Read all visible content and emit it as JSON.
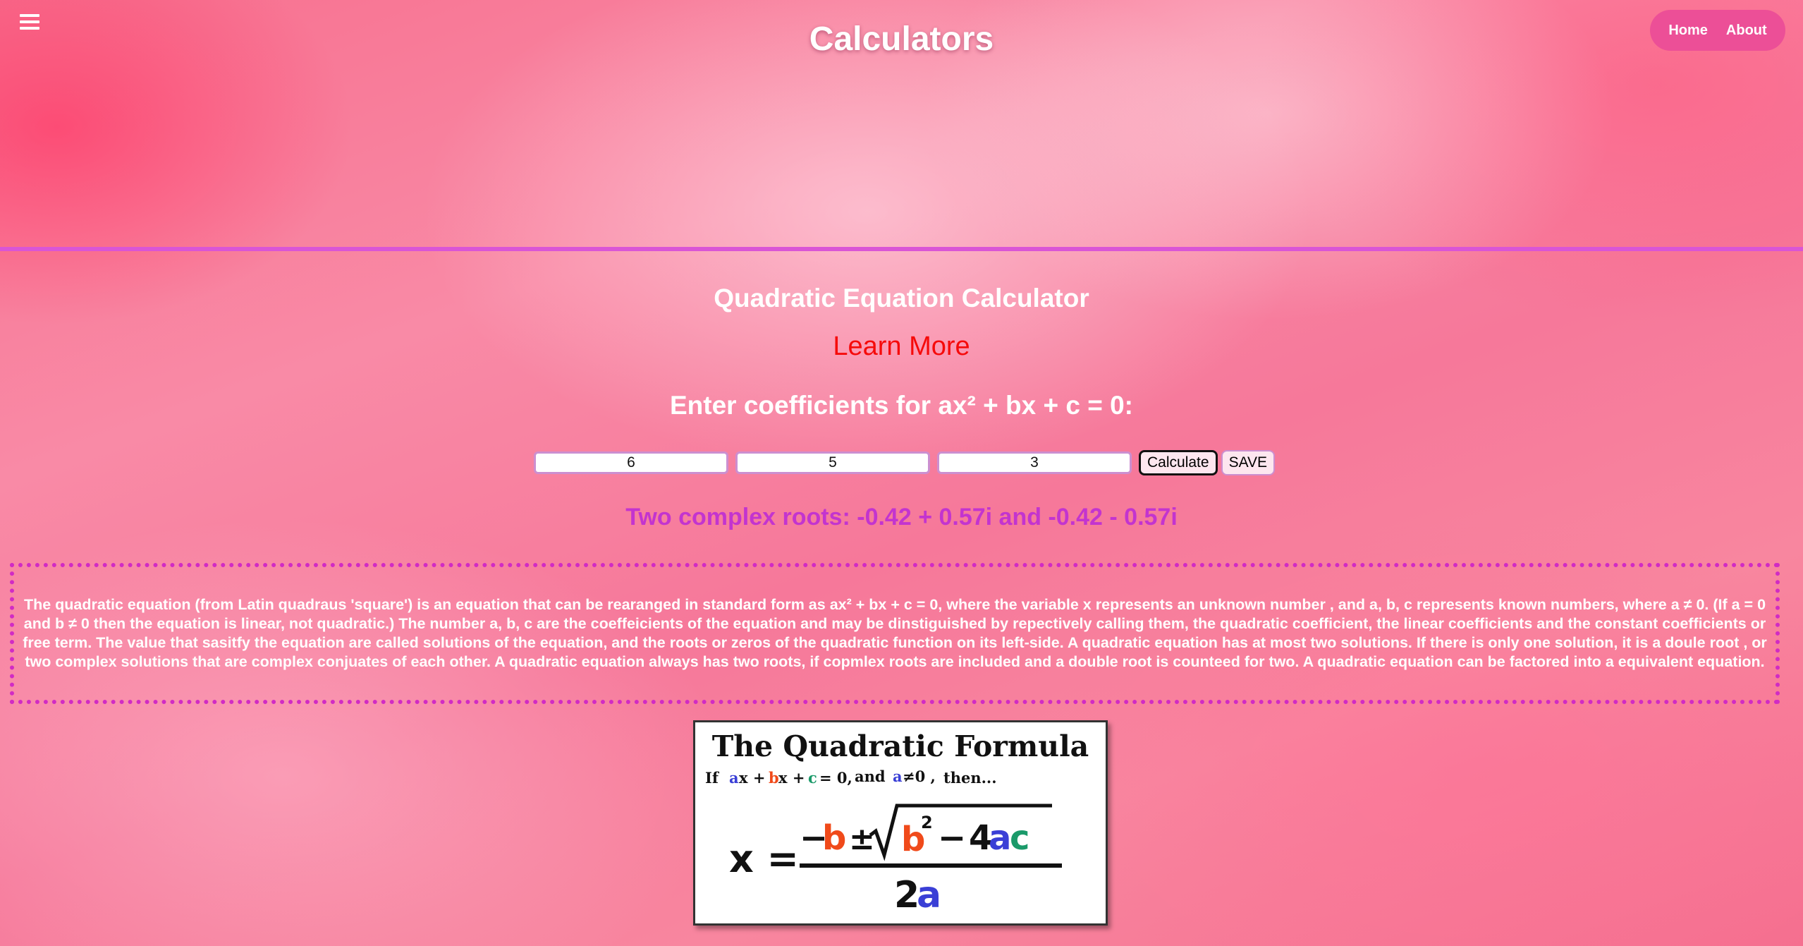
{
  "header": {
    "title": "Calculators",
    "nav": [
      {
        "label": "Home"
      },
      {
        "label": "About"
      }
    ]
  },
  "calculator": {
    "title": "Quadratic Equation Calculator",
    "learn_more": "Learn More",
    "prompt": "Enter coefficients for ax² + bx + c = 0:",
    "inputs": {
      "a": "6",
      "b": "5",
      "c": "3"
    },
    "calculate_label": "Calculate",
    "save_label": "SAVE",
    "result": "Two complex roots: -0.42 + 0.57i and -0.42 - 0.57i"
  },
  "description": "The quadratic equation (from Latin quadraus 'square') is an equation that can be rearanged in standard form as ax² + bx + c = 0, where the variable x represents an unknown number , and a, b, c represents known numbers, where a ≠ 0. (If a = 0 and b ≠ 0 then the equation is linear, not quadratic.) The number a, b, c are the coeffeicients of the equation and may be dinstiguished by repectively calling them, the quadratic coefficient, the linear coefficients and the constant coefficients or free term. The value that sasitfy the equation are called solutions of the equation, and the roots or zeros of the quadratic function on its left-side. A quadratic equation has at most two solutions. If there is only one solution, it is a doule root , or two complex solutions that are complex conjuates of each other. A quadratic equation always has two roots, if copmlex roots are included and a double root is counteed for two. A quadratic equation can be factored into a equivalent equation.",
  "formula_image": {
    "title": "The Quadratic Formula",
    "condition_if": "If",
    "condition_and": "and",
    "condition_then": "then...",
    "colors": {
      "a": "#3a3fd6",
      "b": "#f04a1a",
      "c": "#1b9a6a"
    }
  },
  "colors": {
    "nav_pill": "#ec4f97",
    "divider": "#d955d6",
    "learn_more": "#f60a0a",
    "result": "#c334cf",
    "dotted_border": "#d12bc4"
  }
}
